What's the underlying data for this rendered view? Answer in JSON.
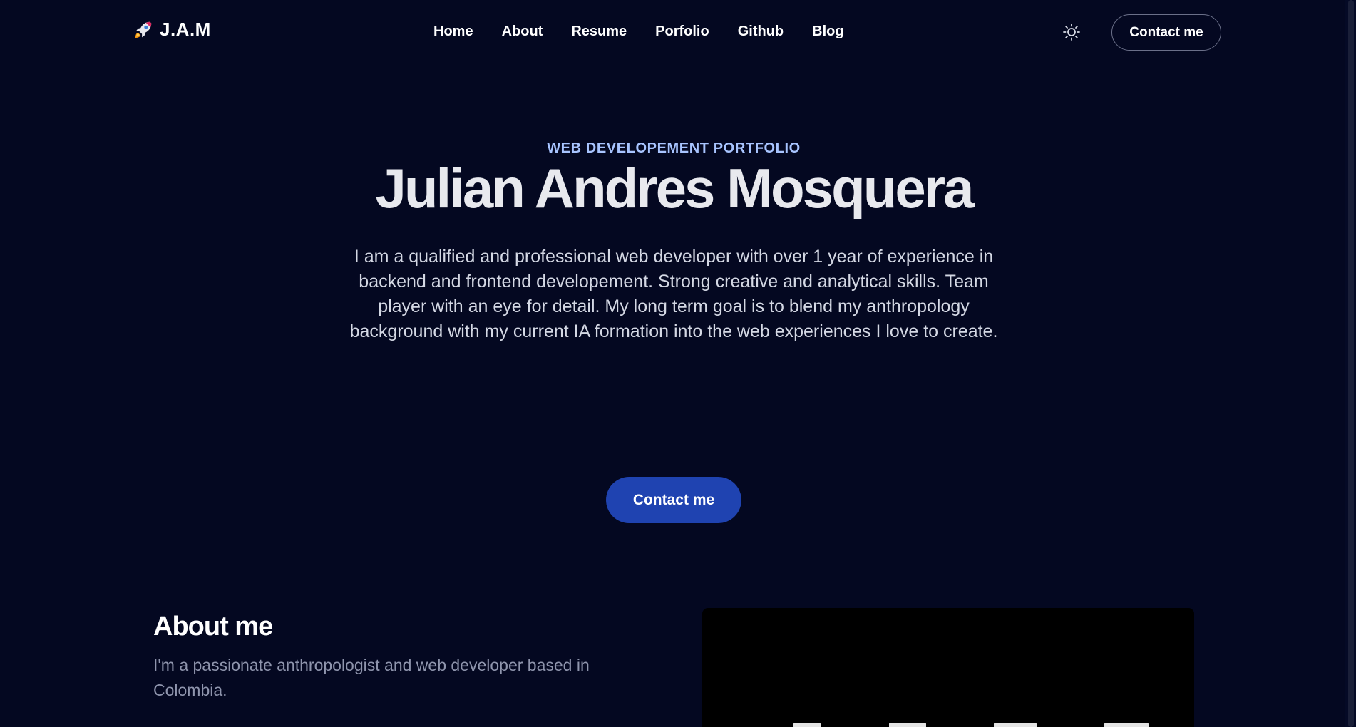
{
  "header": {
    "brand": {
      "icon": "rocket-icon",
      "name": "J.A.M"
    },
    "nav": [
      {
        "label": "Home"
      },
      {
        "label": "About"
      },
      {
        "label": "Resume"
      },
      {
        "label": "Porfolio"
      },
      {
        "label": "Github"
      },
      {
        "label": "Blog"
      }
    ],
    "theme_toggle_icon": "sun-icon",
    "contact_label": "Contact me"
  },
  "hero": {
    "eyebrow": "WEB DEVELOPEMENT PORTFOLIO",
    "title": "Julian Andres Mosquera",
    "description": "I am a qualified and professional web developer with over 1 year of experience in backend and frontend developement. Strong creative and analytical skills. Team player with an eye for detail. My long term goal is to blend my anthropology background with my current IA formation into the web experiences I love to create.",
    "cta_label": "Contact me"
  },
  "about": {
    "title": "About me",
    "description": "I'm a passionate anthropologist and web developer based in Colombia."
  },
  "colors": {
    "background": "#040821",
    "accent": "#1f43b1",
    "eyebrow": "#a8c4ff",
    "muted_text": "#8f95ad"
  }
}
